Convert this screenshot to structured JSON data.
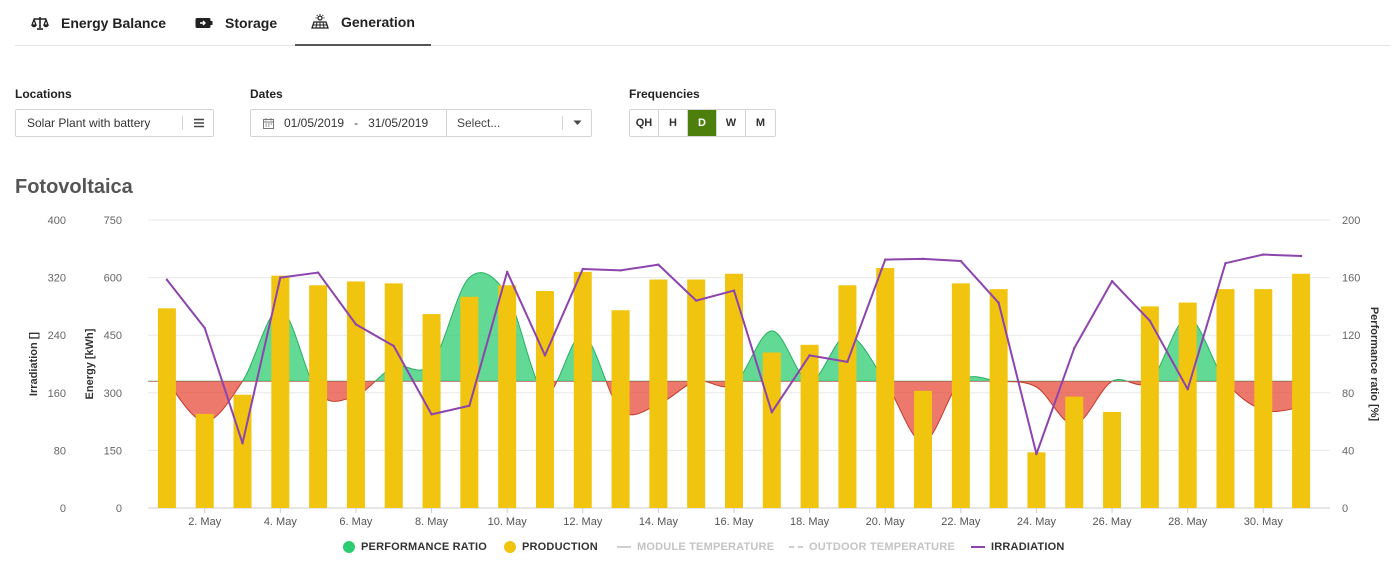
{
  "tabs": [
    {
      "label": "Energy Balance",
      "icon": "scale-icon"
    },
    {
      "label": "Storage",
      "icon": "battery-icon"
    },
    {
      "label": "Generation",
      "icon": "solar-panel-icon"
    }
  ],
  "active_tab": "Generation",
  "filters": {
    "locations_label": "Locations",
    "location_value": "Solar Plant with battery",
    "dates_label": "Dates",
    "date_from": "01/05/2019",
    "date_separator": "-",
    "date_to": "31/05/2019",
    "date_preset_placeholder": "Select...",
    "frequencies_label": "Frequencies",
    "frequencies": [
      "QH",
      "H",
      "D",
      "W",
      "M"
    ],
    "frequency_selected": "D"
  },
  "section_title": "Fotovoltaica",
  "colors": {
    "production": "#f1c40f",
    "perf_positive": "#2ecc71",
    "perf_negative": "#e74c3c",
    "irradiation": "#8e44ad",
    "active_frequency": "#4d7f0c"
  },
  "chart_data": {
    "type": "bar",
    "x": [
      1,
      2,
      3,
      4,
      5,
      6,
      7,
      8,
      9,
      10,
      11,
      12,
      13,
      14,
      15,
      16,
      17,
      18,
      19,
      20,
      21,
      22,
      23,
      24,
      25,
      26,
      27,
      28,
      29,
      30,
      31
    ],
    "x_tick_labels": [
      "2. May",
      "4. May",
      "6. May",
      "8. May",
      "10. May",
      "12. May",
      "14. May",
      "16. May",
      "18. May",
      "20. May",
      "22. May",
      "24. May",
      "26. May",
      "28. May",
      "30. May"
    ],
    "axes": {
      "irradiation": {
        "label": "Irradiation []",
        "ticks": [
          "0",
          "80",
          "160",
          "240",
          "320",
          "400"
        ],
        "range": [
          0,
          400
        ]
      },
      "energy": {
        "label": "Energy [kWh]",
        "ticks": [
          "0",
          "150",
          "300",
          "450",
          "600",
          "750"
        ],
        "range": [
          0,
          750
        ]
      },
      "performance_ratio": {
        "label": "Performance ratio [%]",
        "ticks": [
          "0",
          "40",
          "80",
          "120",
          "160",
          "200"
        ],
        "range": [
          0,
          200
        ]
      }
    },
    "grid": true,
    "legend_position": "bottom",
    "series": [
      {
        "name": "PRODUCTION",
        "axis": "energy",
        "type": "bar",
        "values": [
          520,
          245,
          295,
          605,
          580,
          590,
          585,
          505,
          550,
          580,
          565,
          615,
          515,
          595,
          595,
          610,
          405,
          425,
          580,
          625,
          305,
          585,
          570,
          145,
          290,
          250,
          525,
          535,
          570,
          570,
          610
        ]
      },
      {
        "name": "PERFORMANCE RATIO",
        "axis": "performance_ratio",
        "type": "area",
        "baseline": 88,
        "values": [
          88,
          60,
          88,
          138,
          80,
          78,
          98,
          100,
          160,
          148,
          80,
          120,
          68,
          72,
          88,
          86,
          123,
          88,
          120,
          88,
          46,
          88,
          88,
          84,
          58,
          88,
          88,
          132,
          88,
          68,
          70
        ]
      },
      {
        "name": "IRRADIATION",
        "axis": "irradiation",
        "type": "line",
        "values": [
          317,
          250,
          90,
          320,
          327,
          255,
          225,
          130,
          142,
          328,
          212,
          332,
          330,
          338,
          288,
          302,
          133,
          212,
          203,
          345,
          346,
          343,
          285,
          75,
          222,
          315,
          260,
          165,
          340,
          352,
          350
        ]
      },
      {
        "name": "MODULE TEMPERATURE",
        "type": "line",
        "hidden": true,
        "values": []
      },
      {
        "name": "OUTDOOR TEMPERATURE",
        "type": "line",
        "hidden": true,
        "values": []
      }
    ]
  }
}
